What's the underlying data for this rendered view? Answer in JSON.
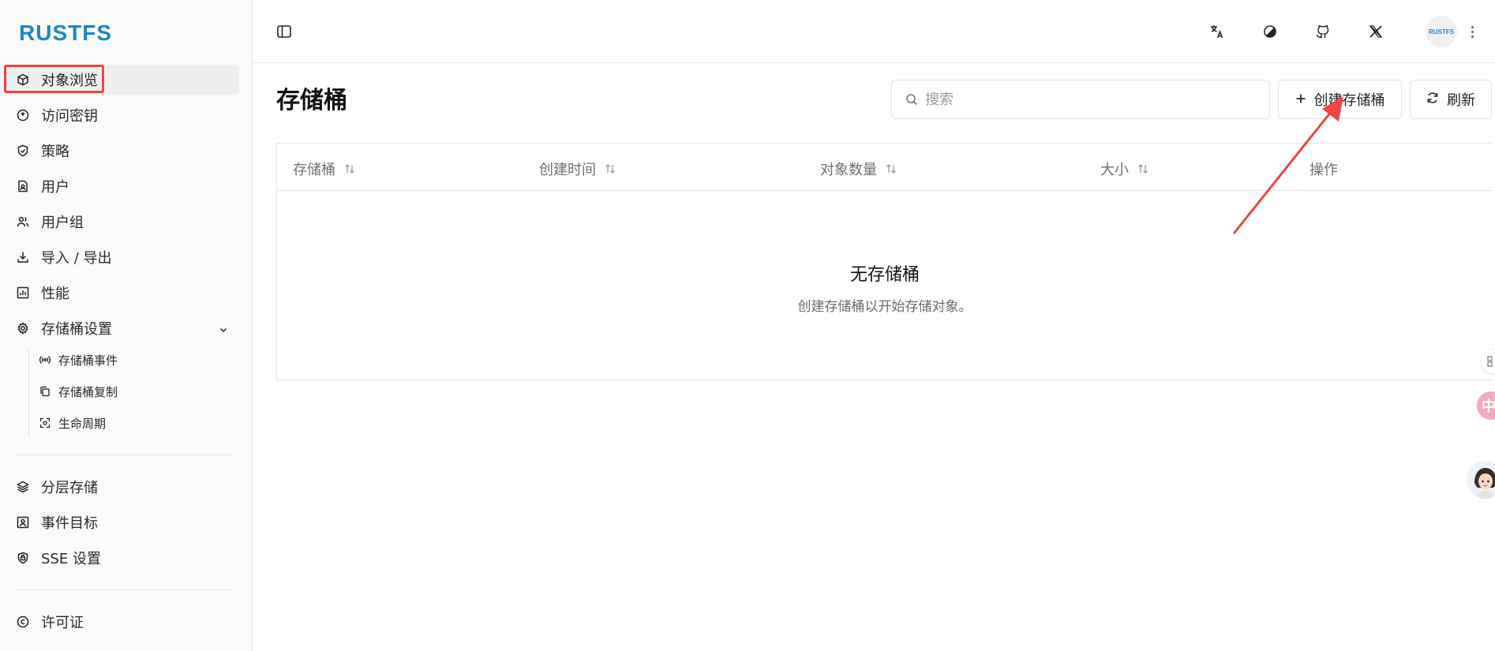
{
  "app": {
    "logo": "RUSTFS",
    "avatar_text": "RUSTFS"
  },
  "sidebar": {
    "items": [
      {
        "label": "对象浏览",
        "icon": "box-icon"
      },
      {
        "label": "访问密钥",
        "icon": "key-circle-icon"
      },
      {
        "label": "策略",
        "icon": "shield-check-icon"
      },
      {
        "label": "用户",
        "icon": "user-file-icon"
      },
      {
        "label": "用户组",
        "icon": "users-icon"
      },
      {
        "label": "导入 / 导出",
        "icon": "download-icon"
      },
      {
        "label": "性能",
        "icon": "chart-icon"
      },
      {
        "label": "存储桶设置",
        "icon": "gear-icon"
      }
    ],
    "sub_items": [
      {
        "label": "存储桶事件",
        "icon": "broadcast-icon"
      },
      {
        "label": "存储桶复制",
        "icon": "copy-icon"
      },
      {
        "label": "生命周期",
        "icon": "lifecycle-icon"
      }
    ],
    "items2": [
      {
        "label": "分层存储",
        "icon": "layers-icon"
      },
      {
        "label": "事件目标",
        "icon": "target-icon"
      },
      {
        "label": "SSE 设置",
        "icon": "sse-icon"
      }
    ],
    "items3": [
      {
        "label": "许可证",
        "icon": "copyright-icon"
      }
    ]
  },
  "header": {
    "icons": [
      "translate-icon",
      "theme-icon",
      "github-icon",
      "x-icon"
    ]
  },
  "main": {
    "title": "存储桶",
    "search_placeholder": "搜索",
    "create_label": "创建存储桶",
    "refresh_label": "刷新",
    "columns": [
      "存储桶",
      "创建时间",
      "对象数量",
      "大小",
      "操作"
    ],
    "empty_title": "无存储桶",
    "empty_desc": "创建存储桶以开始存储对象。"
  },
  "float": {
    "lang_glyph": "中"
  },
  "colors": {
    "brand": "#1b86c8",
    "annotation": "#ee4444"
  }
}
